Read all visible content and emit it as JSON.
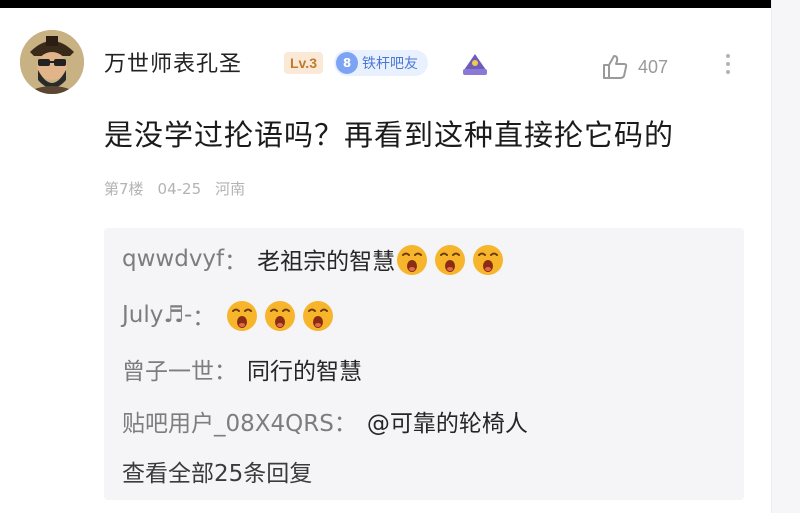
{
  "post": {
    "username": "万世师表孔圣",
    "level": "Lv.3",
    "badge_num": "8",
    "badge_label": "铁杆吧友",
    "likes": "407",
    "content": "是没学过抡语吗？再看到这种直接抡它码的",
    "floor": "第7楼",
    "date": "04-25",
    "location": "河南"
  },
  "replies": [
    {
      "user": "qwwdvyf",
      "sep": "：",
      "text": "老祖宗的智慧",
      "emoji_count": 3
    },
    {
      "user": "July♬-",
      "sep": "：",
      "text": "",
      "emoji_count": 3
    },
    {
      "user": "曾子一世",
      "sep": "：",
      "text": "同行的智慧",
      "emoji_count": 0
    },
    {
      "user": "贴吧用户_08X4QRS",
      "sep": "：",
      "text": "@可靠的轮椅人",
      "emoji_count": 0
    }
  ],
  "view_all": "查看全部25条回复",
  "colors": {
    "emoji": "#f7b52b",
    "badge_blue": "#7da4f4",
    "level_bg": "#fbe9d8"
  },
  "icons": [
    "avatar",
    "fan-badge-icon",
    "crown-hat-icon",
    "thumb-up-icon",
    "more-icon",
    "yawn-emoji-icon"
  ]
}
